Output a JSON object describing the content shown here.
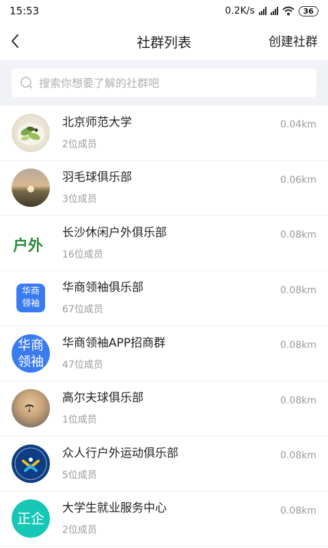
{
  "status_bar": {
    "time": "15:53",
    "speed": "0.2K/s",
    "battery": "36"
  },
  "nav": {
    "title": "社群列表",
    "action": "创建社群"
  },
  "search": {
    "placeholder": "搜索你想要了解的社群吧"
  },
  "groups": [
    {
      "name": "北京师范大学",
      "members": "2位成员",
      "distance": "0.04km",
      "avatar": "food-salad"
    },
    {
      "name": "羽毛球俱乐部",
      "members": "3位成员",
      "distance": "0.06km",
      "avatar": "sunset"
    },
    {
      "name": "长沙休闲户外俱乐部",
      "members": "16位成员",
      "distance": "0.08km",
      "avatar": "outdoor-logo"
    },
    {
      "name": "华商领袖俱乐部",
      "members": "67位成员",
      "distance": "0.08km",
      "avatar": "huashang-logo-square"
    },
    {
      "name": "华商领袖APP招商群",
      "members": "47位成员",
      "distance": "0.08km",
      "avatar": "huashang-logo-circle"
    },
    {
      "name": "高尔夫球俱乐部",
      "members": "1位成员",
      "distance": "0.08km",
      "avatar": "paraglider-sunset"
    },
    {
      "name": "众人行户外运动俱乐部",
      "members": "5位成员",
      "distance": "0.08km",
      "avatar": "zhongrenxing-logo"
    },
    {
      "name": "大学生就业服务中心",
      "members": "2位成员",
      "distance": "0.08km",
      "avatar": "zhengqi-logo"
    }
  ],
  "avatar_text": {
    "outdoor": "户外",
    "huashang_top": "华商",
    "huashang_bottom": "领袖",
    "zhengqi": "正企"
  },
  "colors": {
    "search_bg": "#f1f2f6",
    "huashang_blue": "#3a7bf0",
    "zhengqi_teal": "#16c7b5",
    "zhongrenxing_navy": "#0d3d85"
  }
}
